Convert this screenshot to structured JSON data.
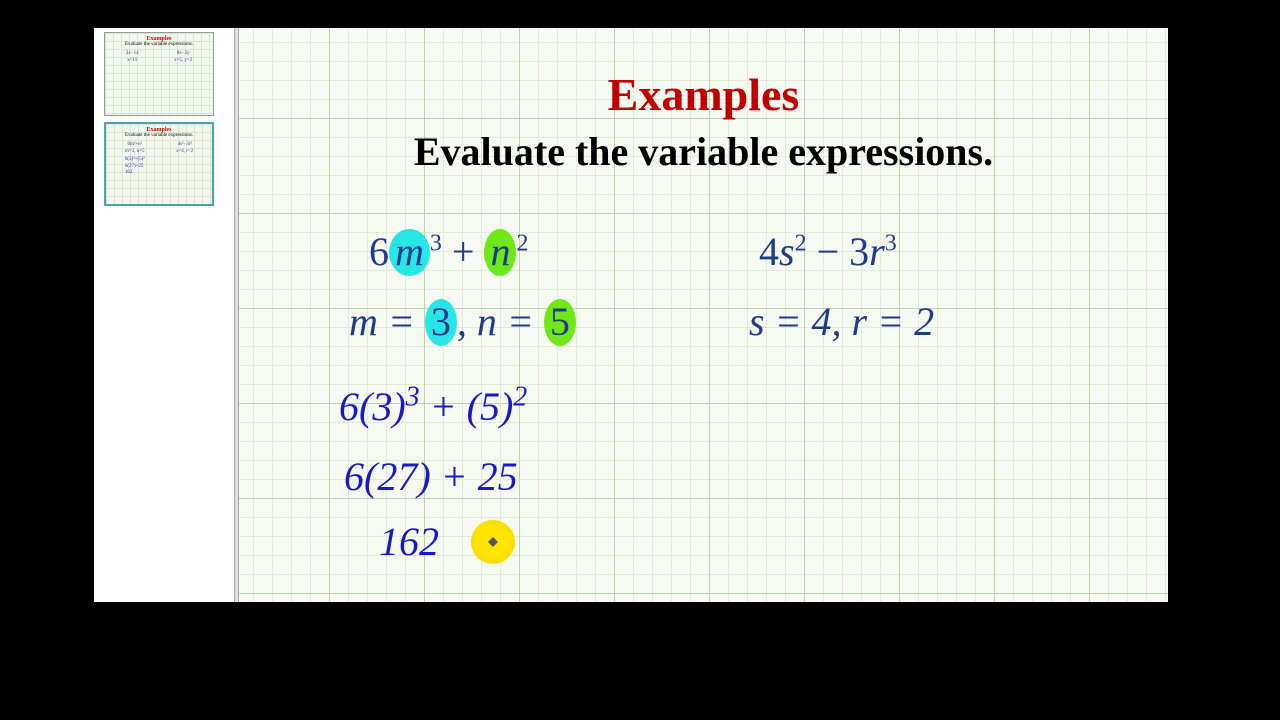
{
  "sidebar": {
    "thumb1": {
      "title": "Examples",
      "sub": "Evaluate the variable expressions.",
      "l1": "3x−14",
      "l2": "x=11",
      "r1": "8x−2y",
      "r2": "x=5, y=2"
    },
    "thumb2": {
      "title": "Examples",
      "sub": "Evaluate the variable expressions.",
      "l1": "6m³+n²",
      "l2": "m=3, n=5",
      "r1": "4s²−3r³",
      "r2": "s=4, r=2",
      "hand": "6(3)³+(5)²\n6(27)+25\n162"
    }
  },
  "title": "Examples",
  "subtitle": "Evaluate the variable expressions.",
  "problem1": {
    "coef1": "6",
    "var1": "m",
    "pow1": "3",
    "op": " + ",
    "var2": "n",
    "pow2": "2",
    "vals_pre": "m = ",
    "val_m": "3",
    "vals_mid": ", n = ",
    "val_n": "5"
  },
  "problem2": {
    "expr": "4s² − 3r³",
    "coef1": "4",
    "var1": "s",
    "pow1": "2",
    "op": " − ",
    "coef2": "3",
    "var2": "r",
    "pow2": "3",
    "vals": "s = 4, r = 2"
  },
  "work": {
    "line1": "6(3)³ + (5)²",
    "line1_a": "6(3)",
    "line1_p1": "3",
    "line1_b": " + (5)",
    "line1_p2": "2",
    "line2": "6(27) + 25",
    "line3": "162"
  }
}
